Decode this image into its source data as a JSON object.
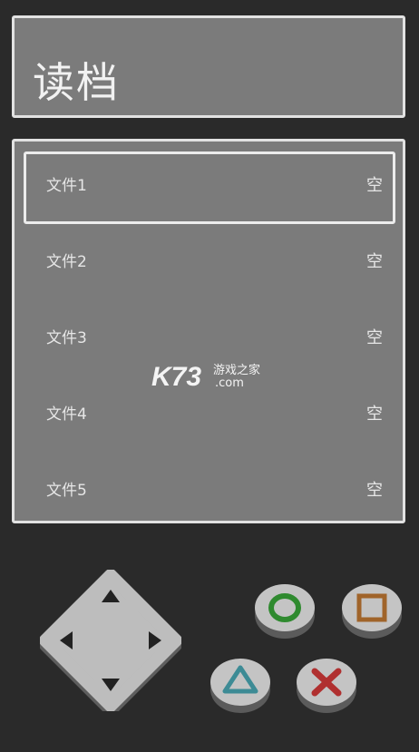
{
  "title": "读档",
  "slots": [
    {
      "name": "文件1",
      "status": "空"
    },
    {
      "name": "文件2",
      "status": "空"
    },
    {
      "name": "文件3",
      "status": "空"
    },
    {
      "name": "文件4",
      "status": "空"
    },
    {
      "name": "文件5",
      "status": "空"
    }
  ],
  "selected_slot": 1,
  "watermark": {
    "brand": "K73",
    "line1": "游戏之家",
    "line2": ".com"
  },
  "controls": {
    "dpad_icon": "dpad-icon",
    "buttons": [
      "circle-button",
      "square-button",
      "triangle-button",
      "cross-button"
    ]
  },
  "colors": {
    "background": "#2a2a2a",
    "panel": "#7b7b7b",
    "panel_border": "#e2e2e2",
    "circle": "#2f8a2f",
    "square": "#a0642a",
    "triangle": "#3d8b95",
    "cross": "#b03030"
  }
}
